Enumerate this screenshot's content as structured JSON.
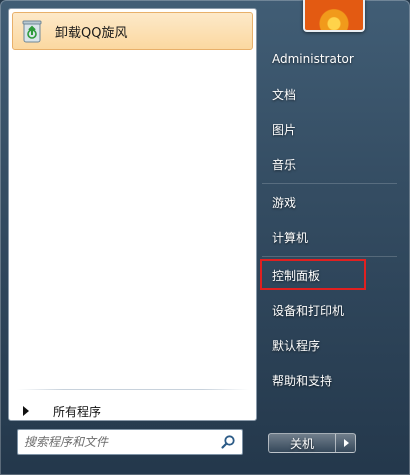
{
  "recent": [
    {
      "label": "卸载QQ旋风",
      "icon": "recycle-bin-icon"
    }
  ],
  "all_programs": {
    "label": "所有程序"
  },
  "search": {
    "placeholder": "搜索程序和文件"
  },
  "user": {
    "name": "Administrator"
  },
  "right_items": [
    {
      "label": "Administrator"
    },
    {
      "label": "文档"
    },
    {
      "label": "图片"
    },
    {
      "label": "音乐"
    },
    {
      "label": "游戏"
    },
    {
      "label": "计算机"
    },
    {
      "label": "控制面板"
    },
    {
      "label": "设备和打印机"
    },
    {
      "label": "默认程序"
    },
    {
      "label": "帮助和支持"
    }
  ],
  "shutdown": {
    "label": "关机"
  },
  "colors": {
    "highlight": "#e02020",
    "hover": "#fbd8a0"
  }
}
